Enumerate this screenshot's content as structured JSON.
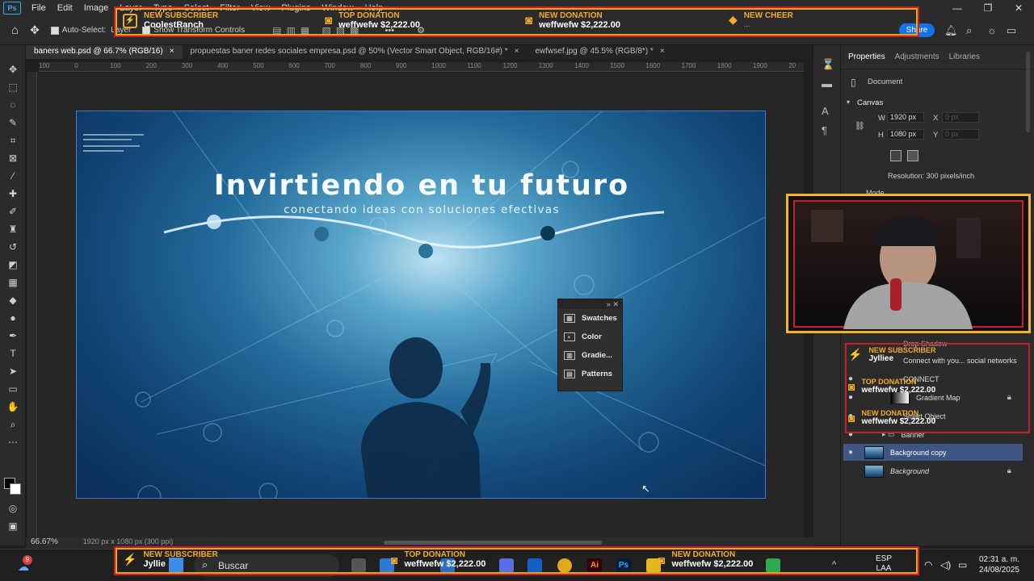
{
  "menu": {
    "logo": "Ps",
    "items": [
      "File",
      "Edit",
      "Image",
      "Layer",
      "Type",
      "Select",
      "Filter",
      "View",
      "Plugins",
      "Window",
      "Help"
    ],
    "window_controls": [
      "—",
      "❐",
      "✕"
    ]
  },
  "options_bar": {
    "auto_select": "Auto-Select:",
    "auto_select_value": "Layer",
    "show_transform": "Show Transform Controls",
    "share": "Share"
  },
  "tabs": [
    {
      "label": "baners web.psd @ 66.7% (RGB/16)",
      "close": "×"
    },
    {
      "label": "propuestas baner redes sociales empresa.psd @ 50% (Vector Smart Object, RGB/16#) *",
      "close": "×"
    },
    {
      "label": "ewfwsef.jpg @ 45.5% (RGB/8*) *",
      "close": "×"
    }
  ],
  "ruler": [
    "100",
    "0",
    "100",
    "200",
    "300",
    "400",
    "500",
    "600",
    "700",
    "800",
    "900",
    "1000",
    "1100",
    "1200",
    "1300",
    "1400",
    "1500",
    "1600",
    "1700",
    "1800",
    "1900",
    "20"
  ],
  "banner": {
    "headline": "Invirtiendo en tu futuro",
    "subline": "conectando ideas con soluciones efectivas"
  },
  "floating_panel": {
    "items": [
      "Swatches",
      "Color",
      "Gradie...",
      "Patterns"
    ]
  },
  "properties": {
    "tabs": [
      "Properties",
      "Adjustments",
      "Libraries"
    ],
    "document": "Document",
    "section": "Canvas",
    "w_label": "W",
    "w_value": "1920 px",
    "h_label": "H",
    "h_value": "1080 px",
    "x_label": "X",
    "x_placeholder": "0 px",
    "y_label": "Y",
    "y_placeholder": "0 px",
    "resolution": "Resolution: 300 pixels/inch",
    "mode": "Mode"
  },
  "layers": [
    {
      "name": "Drop Shadow"
    },
    {
      "name": "Connect with you... social networks"
    },
    {
      "name": "CONNECT"
    },
    {
      "name": "Gradient Map"
    },
    {
      "name": "Smart Object"
    },
    {
      "name": "Banner"
    },
    {
      "name": "Background copy"
    },
    {
      "name": "Background"
    }
  ],
  "alerts_top": [
    {
      "title": "NEW SUBSCRIBER",
      "value": "CoolestRanch"
    },
    {
      "title": "TOP DONATION",
      "value": "weffwefw $2,222.00"
    },
    {
      "title": "NEW DONATION",
      "value": "weffwefw $2,222.00"
    },
    {
      "title": "NEW CHEER",
      "value": "..."
    }
  ],
  "alerts_side": [
    {
      "title": "NEW SUBSCRIBER",
      "value": "Jylliee"
    },
    {
      "title": "TOP DONATION",
      "value": "weffwefw $2,222.00"
    },
    {
      "title": "NEW DONATION",
      "value": "weffwefw $2,222.00"
    }
  ],
  "alerts_bottom": [
    {
      "title": "NEW SUBSCRIBER",
      "value": "Jyllie"
    },
    {
      "title": "TOP DONATION",
      "value": "weffwefw $2,222.00"
    },
    {
      "title": "NEW DONATION",
      "value": "weffwefw $2,222.00"
    }
  ],
  "status": {
    "zoom": "66.67%",
    "size": "1920 px x 1080 px (300 ppi)"
  },
  "taskbar": {
    "search": "Buscar",
    "lang1": "ESP",
    "lang2": "LAA",
    "time": "02:31 a. m.",
    "date": "24/08/2025",
    "badge": "9"
  }
}
